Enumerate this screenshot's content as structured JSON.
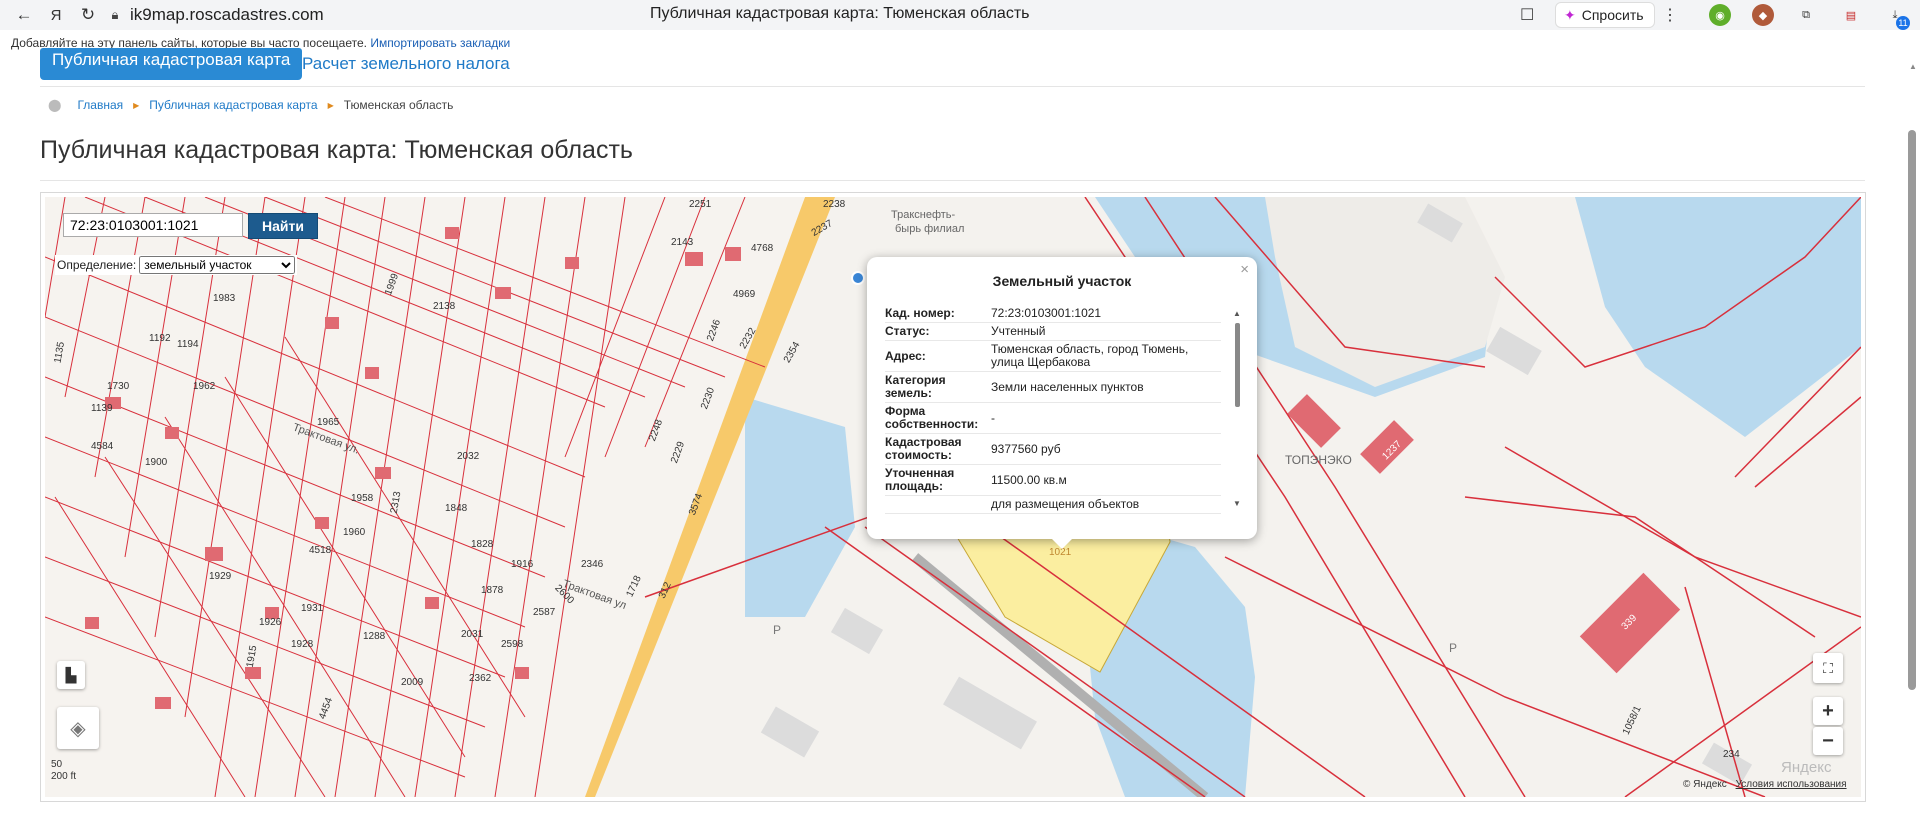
{
  "browser": {
    "url": "ik9map.roscadastres.com",
    "tab_title": "Публичная кадастровая карта: Тюменская область",
    "ask_label": "Спросить",
    "ext_badge": "11"
  },
  "bookmarks_bar": {
    "prompt": "Добавляйте на эту панель сайты, которые вы часто посещаете.",
    "import_link": "Импортировать закладки"
  },
  "site_tabs": {
    "active": "Публичная кадастровая карта",
    "other": "Расчет земельного налога"
  },
  "breadcrumb": {
    "home": "Главная",
    "section": "Публичная кадастровая карта",
    "current": "Тюменская область"
  },
  "page_title": "Публичная кадастровая карта: Тюменская область",
  "map": {
    "search_value": "72:23:0103001:1021",
    "search_button": "Найти",
    "definition_label": "Определение:",
    "definition_value": "земельный участок",
    "scale_top": "50",
    "scale_bottom": "200 ft",
    "copyright": "© Яндекс",
    "terms_link": "Условия использования",
    "yandex_logo": "Яндекс",
    "zoom_in": "+",
    "zoom_out": "−",
    "labels": {
      "street1": "Трактовая ул.",
      "street2": "Трактовая ул",
      "place1": "Тракснефть-",
      "place2": "бырь филиал",
      "place3": "ТОПЭНЭКО",
      "parking1": "P",
      "parking2": "P",
      "parcel_main": "1021",
      "p1": "2251",
      "p2": "2143",
      "p3": "4768",
      "p4": "4969",
      "p5": "2237",
      "p6": "2238",
      "p7": "2232",
      "p8": "2354",
      "p9": "2246",
      "p10": "2230",
      "p11": "2248",
      "p12": "2229",
      "p13": "3574",
      "p14": "1983",
      "p15": "1962",
      "p16": "1900",
      "p17": "1965",
      "p18": "1958",
      "p19": "2313",
      "p20": "1848",
      "p21": "1828",
      "p22": "1916",
      "p23": "2346",
      "p24": "1960",
      "p25": "4518",
      "p26": "1929",
      "p27": "1926",
      "p28": "1931",
      "p29": "1928",
      "p30": "1915",
      "p31": "2587",
      "p32": "2598",
      "p33": "2362",
      "p34": "2009",
      "p35": "1718",
      "p36": "312",
      "p37": "4584",
      "p38": "1135",
      "p39": "1139",
      "p40": "1730",
      "p41": "1194",
      "p42": "1192",
      "p43": "2138",
      "p44": "1999",
      "p45": "2032",
      "p46": "1878",
      "p47": "2600",
      "p48": "2031",
      "p49": "1288",
      "p50": "4454",
      "p51": "339",
      "p52": "234",
      "p53": "1237",
      "p54": "1058/1"
    }
  },
  "popup": {
    "title": "Земельный участок",
    "close": "×",
    "rows": [
      {
        "key": "Кад. номер:",
        "value": "72:23:0103001:1021"
      },
      {
        "key": "Статус:",
        "value": "Учтенный"
      },
      {
        "key": "Адрес:",
        "value": "Тюменская область, город Тюмень, улица Щербакова"
      },
      {
        "key": "Категория земель:",
        "value": "Земли населенных пунктов"
      },
      {
        "key": "Форма собственности:",
        "value": "-"
      },
      {
        "key": "Кадастровая стоимость:",
        "value": "9377560 руб"
      },
      {
        "key": "Уточненная площадь:",
        "value": "11500.00 кв.м"
      },
      {
        "key": "",
        "value": "для размещения объектов"
      }
    ]
  },
  "colors": {
    "parcel_line": "#d8303c",
    "selected_parcel": "#fbeea0",
    "water": "#b8d9ee",
    "building": "#e06a72",
    "primary_button": "#1d5b8e",
    "active_tab": "#2a8ad4",
    "link": "#1f7ac7"
  }
}
